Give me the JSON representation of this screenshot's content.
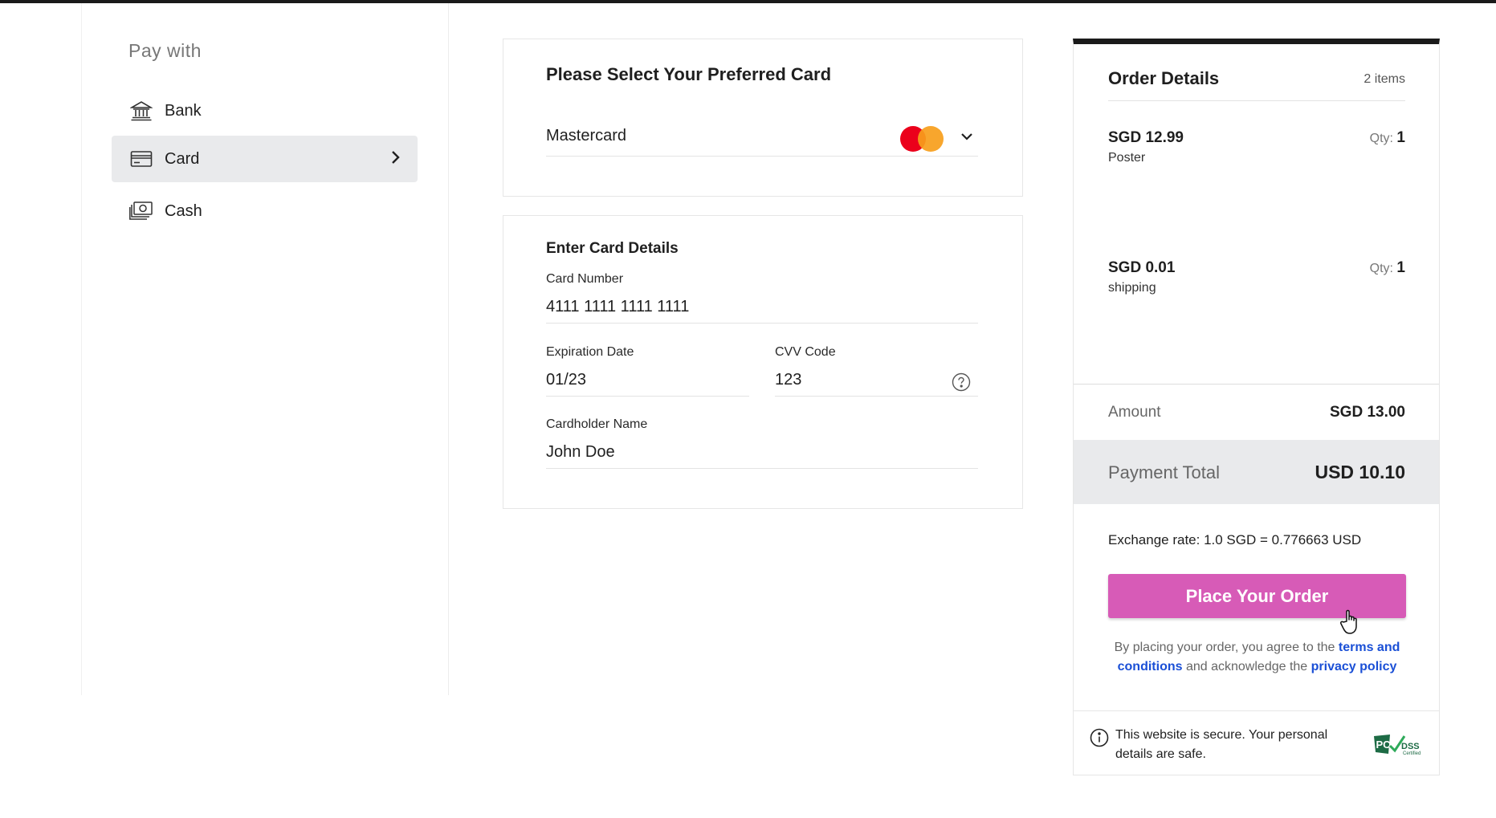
{
  "sidebar": {
    "heading": "Pay with",
    "items": [
      {
        "label": "Bank",
        "icon": "bank-icon"
      },
      {
        "label": "Card",
        "icon": "credit-card-icon",
        "active": true
      },
      {
        "label": "Cash",
        "icon": "cash-icon"
      }
    ]
  },
  "card_select": {
    "title": "Please Select Your Preferred Card",
    "selected": "Mastercard",
    "brand_icon": "mastercard-logo"
  },
  "card_details": {
    "title": "Enter Card Details",
    "card_number_label": "Card Number",
    "card_number_value": "4111 1111 1111 1111",
    "expiry_label": "Expiration Date",
    "expiry_value": "01/23",
    "cvv_label": "CVV Code",
    "cvv_value": "123",
    "holder_label": "Cardholder Name",
    "holder_value": "John Doe"
  },
  "order": {
    "title": "Order Details",
    "count": "2 items",
    "items": [
      {
        "price": "SGD 12.99",
        "name": "Poster",
        "qty_label": "Qty:",
        "qty": "1"
      },
      {
        "price": "SGD 0.01",
        "name": "shipping",
        "qty_label": "Qty:",
        "qty": "1"
      }
    ],
    "amount_label": "Amount",
    "amount_value": "SGD 13.00",
    "total_label": "Payment Total",
    "total_value": "USD 10.10",
    "exchange_rate": "Exchange rate: 1.0 SGD = 0.776663 USD",
    "button_label": "Place Your Order",
    "button_color": "#d75bb7",
    "terms_prefix": "By placing your order, you agree to the",
    "terms_link": "terms and conditions",
    "terms_mid": "and acknowledge the",
    "privacy_link": "privacy policy",
    "link_color": "#1a4fd6",
    "secure_text": "This website is secure. Your personal details are safe.",
    "badge_text": "PCI DSS Certified"
  }
}
